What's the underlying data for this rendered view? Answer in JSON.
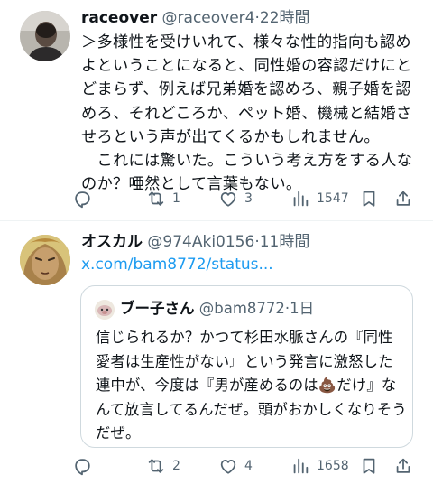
{
  "posts": [
    {
      "display_name": "raceover",
      "handle": "@raceover4",
      "time": "22時間",
      "body": "＞多様性を受けいれて、様々な性的指向も認めよということになると、同性婚の容認だけにとどまらず、例えば兄弟婚を認めろ、親子婚を認めろ、それどころか、ペット婚、機械と結婚させろという声が出てくるかもしれません。\n　これには驚いた。こういう考え方をする人なのか？唖然として言葉もない。",
      "actions": {
        "replies": "",
        "reposts": "1",
        "likes": "3",
        "views": "1547"
      }
    },
    {
      "display_name": "オスカル",
      "handle": "@974Aki0156",
      "time": "11時間",
      "link_text": "x.com/bam8772/status...",
      "quote": {
        "display_name": "ブー子さん",
        "handle": "@bam8772",
        "time": "1日",
        "body_before_emoji": "信じられるか？かつて杉田水脈さんの『同性愛者は生産性がない』という発言に激怒した連中が、今度は『男が産めるのは",
        "emoji": "💩",
        "body_after_emoji": "だけ』なんて放言してるんだぜ。頭がおかしくなりそうだぜ。"
      },
      "actions": {
        "replies": "",
        "reposts": "2",
        "likes": "4",
        "views": "1658"
      }
    }
  ],
  "icons": [
    "reply-icon",
    "repost-icon",
    "like-icon",
    "views-icon",
    "bookmark-icon",
    "share-icon"
  ],
  "colors": {
    "text": "#0f1419",
    "secondary": "#536471",
    "link": "#1d9bf0",
    "border": "#cfd9de"
  }
}
